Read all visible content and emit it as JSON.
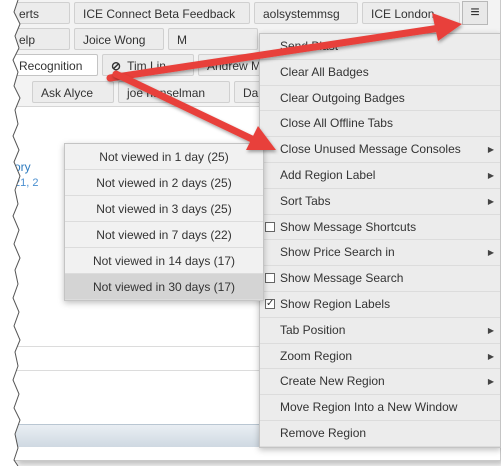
{
  "tab_rows": [
    {
      "tabs": [
        {
          "label": "erts"
        },
        {
          "label": "ICE Connect Beta Feedback"
        },
        {
          "label": "aolsystemmsg"
        },
        {
          "label": "ICE London"
        }
      ]
    },
    {
      "tabs": [
        {
          "label": "elp"
        },
        {
          "label": "Joice Wong"
        },
        {
          "label": "M"
        }
      ]
    },
    {
      "tabs": [
        {
          "label": "Recognition"
        },
        {
          "label": "Tim Lin"
        },
        {
          "label": "Andrew Ma"
        }
      ]
    },
    {
      "tabs": [
        {
          "label": "Ask Alyce"
        },
        {
          "label": "joe hanselman"
        },
        {
          "label": "Da"
        }
      ]
    }
  ],
  "hamburger_icon": "hamburger-menu-icon",
  "hide_icon": "⊘",
  "chat": {
    "link_text": "ory",
    "date_text": "21, 2"
  },
  "menu": {
    "items": [
      {
        "label": "Send Blast",
        "has_submenu": false,
        "checkbox": null
      },
      {
        "label": "Clear All Badges",
        "has_submenu": false,
        "checkbox": null
      },
      {
        "label": "Clear Outgoing Badges",
        "has_submenu": false,
        "checkbox": null
      },
      {
        "label": "Close All Offline Tabs",
        "has_submenu": false,
        "checkbox": null
      },
      {
        "label": "Close Unused Message Consoles",
        "has_submenu": true,
        "checkbox": null
      },
      {
        "label": "Add Region Label",
        "has_submenu": true,
        "checkbox": null
      },
      {
        "label": "Sort Tabs",
        "has_submenu": true,
        "checkbox": null
      },
      {
        "label": "Show Message Shortcuts",
        "has_submenu": false,
        "checkbox": "unchecked"
      },
      {
        "label": "Show Price Search in",
        "has_submenu": true,
        "checkbox": null
      },
      {
        "label": "Show Message Search",
        "has_submenu": false,
        "checkbox": "unchecked"
      },
      {
        "label": "Show Region Labels",
        "has_submenu": false,
        "checkbox": "checked"
      },
      {
        "label": "Tab Position",
        "has_submenu": true,
        "checkbox": null
      },
      {
        "label": "Zoom Region",
        "has_submenu": true,
        "checkbox": null
      },
      {
        "label": "Create New Region",
        "has_submenu": true,
        "checkbox": null
      },
      {
        "label": "Move Region Into a New Window",
        "has_submenu": false,
        "checkbox": null
      },
      {
        "label": "Remove Region",
        "has_submenu": false,
        "checkbox": null
      }
    ]
  },
  "submenu": {
    "items": [
      {
        "label": "Not viewed in 1 day (25)"
      },
      {
        "label": "Not viewed in 2 days (25)"
      },
      {
        "label": "Not viewed in 3 days (25)"
      },
      {
        "label": "Not viewed in 7 days (22)"
      },
      {
        "label": "Not viewed in 14 days (17)"
      },
      {
        "label": "Not viewed in 30 days (17)",
        "highlighted": true
      }
    ]
  },
  "colors": {
    "annotation_arrow": "#e8413a",
    "link": "#2e7bbf",
    "menu_bg": "#ececec",
    "submenu_highlight": "#d4d4d4"
  }
}
